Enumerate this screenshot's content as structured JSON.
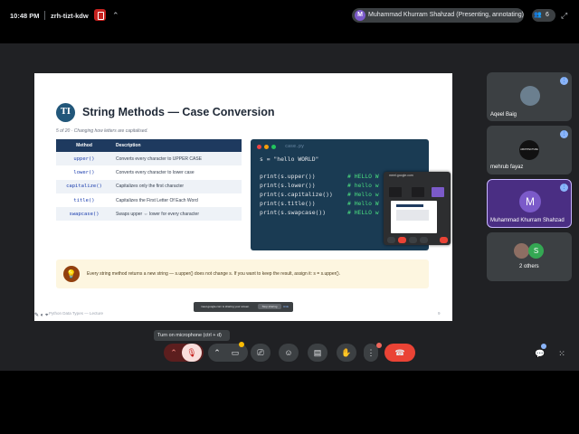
{
  "topbar": {
    "time": "10:48 PM",
    "meeting_code": "zrh-tizt-kdw",
    "presenter_initial": "M",
    "presenter_text": "Muhammad Khurram Shahzad (Presenting, annotating)",
    "participant_count": "6"
  },
  "slide": {
    "logo": "TI",
    "title": "String Methods — Case Conversion",
    "subtitle": "5 of 20 · Changing how letters are capitalised.",
    "table": {
      "headers": [
        "Method",
        "Description"
      ],
      "rows": [
        {
          "method": "upper()",
          "desc": "Converts every character to UPPER CASE"
        },
        {
          "method": "lower()",
          "desc": "Converts every character to lower case"
        },
        {
          "method": "capitalize()",
          "desc": "Capitalizes only the first character"
        },
        {
          "method": "title()",
          "desc": "Capitalizes the First Letter Of Each Word"
        },
        {
          "method": "swapcase()",
          "desc": "Swaps upper ⇔ lower for every character"
        }
      ]
    },
    "code": {
      "filename": "case.py",
      "lines": [
        "s = \"hello WORLD\"",
        "print(s.upper())",
        "print(s.lower())",
        "print(s.capitalize())",
        "print(s.title())",
        "print(s.swapcase())"
      ],
      "comments": [
        "# HELLO W",
        "# hello w",
        "# Hello w",
        "# Hello W",
        "# HELLO w"
      ]
    },
    "note": "Every string method returns a new string — s.upper() does not change s. If you want to keep the result, assign it: s = s.upper().",
    "footer": "Python Data Types — Lecture",
    "page": "9"
  },
  "mini_window": {
    "title": "meet.google.com"
  },
  "share_toast": {
    "text": "meet.google.com is sharing your screen.",
    "stop_label": "Stop sharing",
    "hide_label": "Hide"
  },
  "participants": [
    {
      "name": "Aqeel Baig"
    },
    {
      "name": "mehrub fayaz",
      "avatar_text": "ARCHITECTURE"
    },
    {
      "name": "Muhammad Khurram Shahzad",
      "initial": "M"
    },
    {
      "name": "2 others",
      "initial": "S"
    }
  ],
  "controls": {
    "tooltip": "Turn on microphone (ctrl + d)"
  },
  "colors": {
    "meet_bg": "#202124",
    "tile_bg": "#3c4043",
    "accent_purple": "#7b5ac9",
    "hangup_red": "#ea4335",
    "mic_off_red": "#5c1e1e"
  }
}
